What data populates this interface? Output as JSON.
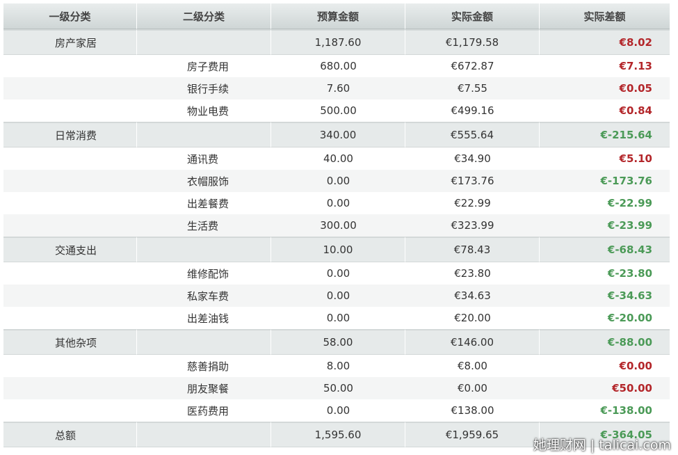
{
  "headers": [
    "一级分类",
    "二级分类",
    "预算金额",
    "实际金额",
    "实际差额"
  ],
  "colors": {
    "over_budget": "#b3262a",
    "under_budget": "#4b9a57"
  },
  "rows": [
    {
      "type": "group",
      "cat1": "房产家居",
      "cat2": "",
      "budget": "1,187.60",
      "actual": "€1,179.58",
      "diff": "€8.02",
      "sign": "neg"
    },
    {
      "type": "item",
      "cat1": "",
      "cat2": "房子费用",
      "budget": "680.00",
      "actual": "€672.87",
      "diff": "€7.13",
      "sign": "neg"
    },
    {
      "type": "item",
      "cat1": "",
      "cat2": "银行手续",
      "budget": "7.60",
      "actual": "€7.55",
      "diff": "€0.05",
      "sign": "neg"
    },
    {
      "type": "item",
      "cat1": "",
      "cat2": "物业电费",
      "budget": "500.00",
      "actual": "€499.16",
      "diff": "€0.84",
      "sign": "neg"
    },
    {
      "type": "group",
      "cat1": "日常消费",
      "cat2": "",
      "budget": "340.00",
      "actual": "€555.64",
      "diff": "€-215.64",
      "sign": "pos"
    },
    {
      "type": "item",
      "cat1": "",
      "cat2": "通讯费",
      "budget": "40.00",
      "actual": "€34.90",
      "diff": "€5.10",
      "sign": "neg"
    },
    {
      "type": "item",
      "cat1": "",
      "cat2": "衣帽服饰",
      "budget": "0.00",
      "actual": "€173.76",
      "diff": "€-173.76",
      "sign": "pos"
    },
    {
      "type": "item",
      "cat1": "",
      "cat2": "出差餐费",
      "budget": "0.00",
      "actual": "€22.99",
      "diff": "€-22.99",
      "sign": "pos"
    },
    {
      "type": "item",
      "cat1": "",
      "cat2": "生活费",
      "budget": "300.00",
      "actual": "€323.99",
      "diff": "€-23.99",
      "sign": "pos"
    },
    {
      "type": "group",
      "cat1": "交通支出",
      "cat2": "",
      "budget": "10.00",
      "actual": "€78.43",
      "diff": "€-68.43",
      "sign": "pos"
    },
    {
      "type": "item",
      "cat1": "",
      "cat2": "维修配饰",
      "budget": "0.00",
      "actual": "€23.80",
      "diff": "€-23.80",
      "sign": "pos"
    },
    {
      "type": "item",
      "cat1": "",
      "cat2": "私家车费",
      "budget": "0.00",
      "actual": "€34.63",
      "diff": "€-34.63",
      "sign": "pos"
    },
    {
      "type": "item",
      "cat1": "",
      "cat2": "出差油钱",
      "budget": "0.00",
      "actual": "€20.00",
      "diff": "€-20.00",
      "sign": "pos"
    },
    {
      "type": "group",
      "cat1": "其他杂项",
      "cat2": "",
      "budget": "58.00",
      "actual": "€146.00",
      "diff": "€-88.00",
      "sign": "pos"
    },
    {
      "type": "item",
      "cat1": "",
      "cat2": "慈善捐助",
      "budget": "8.00",
      "actual": "€8.00",
      "diff": "€0.00",
      "sign": "neg"
    },
    {
      "type": "item",
      "cat1": "",
      "cat2": "朋友聚餐",
      "budget": "50.00",
      "actual": "€0.00",
      "diff": "€50.00",
      "sign": "neg"
    },
    {
      "type": "item",
      "cat1": "",
      "cat2": "医药费用",
      "budget": "0.00",
      "actual": "€138.00",
      "diff": "€-138.00",
      "sign": "pos"
    },
    {
      "type": "group",
      "cat1": "总额",
      "cat2": "",
      "budget": "1,595.60",
      "actual": "€1,959.65",
      "diff": "€-364.05",
      "sign": "pos"
    }
  ],
  "watermark": "她理财网 | talicai.com"
}
